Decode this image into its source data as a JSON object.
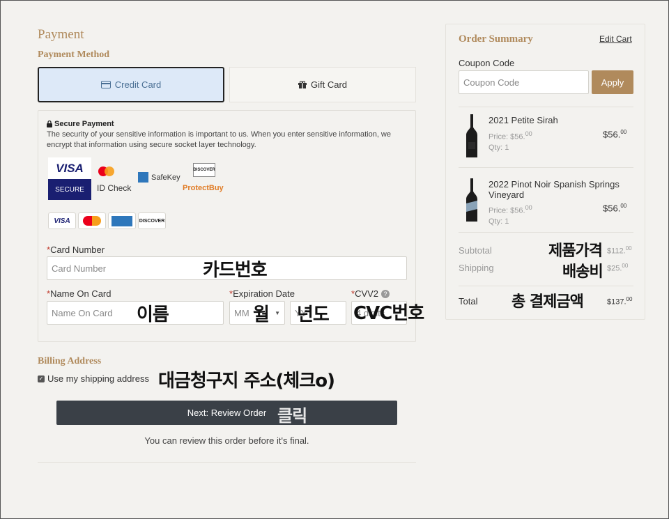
{
  "payment": {
    "title": "Payment",
    "method_title": "Payment Method",
    "tabs": {
      "credit": "Credit Card",
      "gift": "Gift Card"
    },
    "secure": {
      "title": "Secure Payment",
      "text": "The security of your sensitive information is important to us. When you enter sensitive information, we encrypt that information using secure socket layer technology."
    },
    "badges": {
      "visa_top": "VISA",
      "visa_bottom": "SECURE",
      "id_check": "ID Check",
      "safekey": "SafeKey",
      "discover_small": "DISCOVER",
      "protectbuy": "ProtectBuy"
    },
    "card_logos": {
      "visa": "VISA",
      "discover": "DISCOVER"
    },
    "fields": {
      "card_number": {
        "label": "Card Number",
        "placeholder": "Card Number"
      },
      "name_on_card": {
        "label": "Name On Card",
        "placeholder": "Name On Card"
      },
      "expiration": {
        "label": "Expiration Date",
        "month": "MM",
        "year": "YY"
      },
      "cvv": {
        "label": "CVV2",
        "placeholder": "4 digits"
      },
      "required_mark": "*"
    },
    "billing": {
      "title": "Billing Address",
      "use_shipping": "Use my shipping address",
      "checked": true
    },
    "next_button": "Next: Review Order",
    "review_note": "You can review this order before it's final."
  },
  "summary": {
    "title": "Order Summary",
    "edit_cart": "Edit Cart",
    "coupon_label": "Coupon Code",
    "coupon_placeholder": "Coupon Code",
    "apply": "Apply",
    "items": [
      {
        "name": "2021 Petite Sirah",
        "price_line": "Price: $56.",
        "price_cents": "00",
        "qty": "Qty: 1",
        "total": "$56.",
        "total_cents": "00"
      },
      {
        "name": "2022 Pinot Noir Spanish Springs Vineyard",
        "price_line": "Price: $56.",
        "price_cents": "00",
        "qty": "Qty: 1",
        "total": "$56.",
        "total_cents": "00"
      }
    ],
    "subtotal_label": "Subtotal",
    "subtotal": "$112.",
    "subtotal_cents": "00",
    "shipping_label": "Shipping",
    "shipping": "$25.",
    "shipping_cents": "00",
    "total_label": "Total",
    "total": "$137.",
    "total_cents": "00"
  },
  "annotations": {
    "card_number": "카드번호",
    "name": "이름",
    "month": "월",
    "year": "년도",
    "cvc": "CVC번호",
    "billing": "대금청구지 주소(체크o)",
    "click": "클릭",
    "subtotal": "제품가격",
    "shipping": "배송비",
    "total": "총 결제금액"
  },
  "colors": {
    "accent": "#b08a5c",
    "button_dark": "#3a4047",
    "selected_tab": "#dde9f8"
  }
}
